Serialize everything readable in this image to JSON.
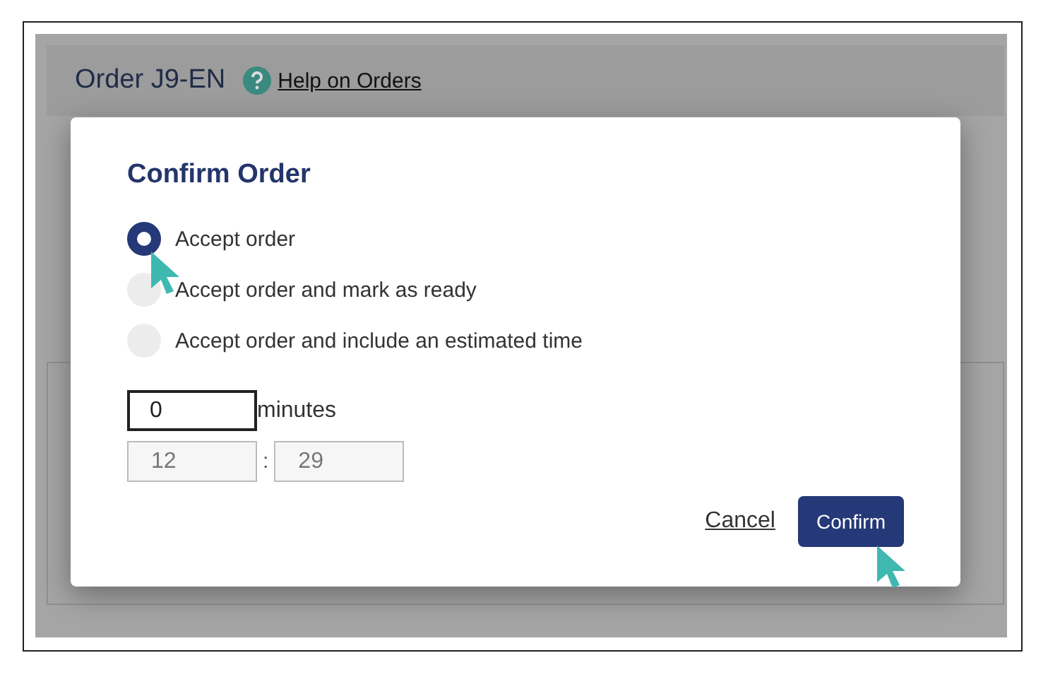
{
  "page": {
    "title": "Order J9-EN",
    "help_link": "Help on Orders"
  },
  "dialog": {
    "title": "Confirm Order",
    "options": [
      {
        "label": "Accept order",
        "selected": true
      },
      {
        "label": "Accept order and mark as ready",
        "selected": false
      },
      {
        "label": "Accept order and include an estimated time",
        "selected": false
      }
    ],
    "minutes": {
      "value": "0",
      "unit": "minutes"
    },
    "time": {
      "hours": "12",
      "separator": ":",
      "minutes": "29",
      "disabled": true
    },
    "buttons": {
      "cancel": "Cancel",
      "confirm": "Confirm"
    }
  }
}
